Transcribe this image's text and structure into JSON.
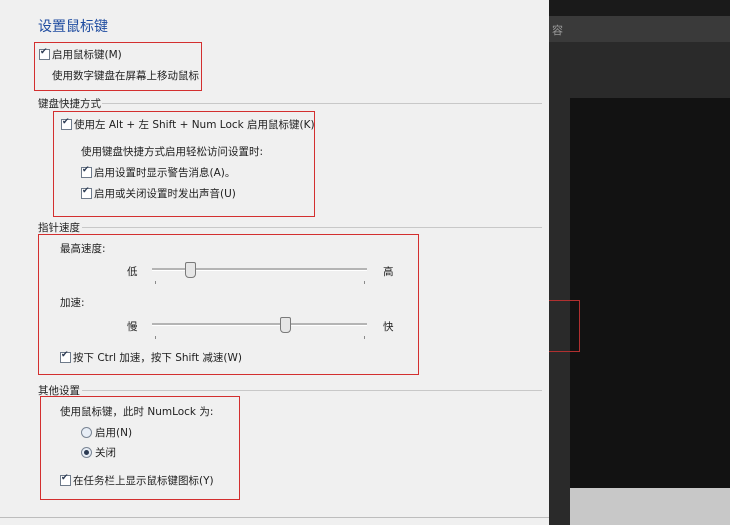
{
  "background": {
    "partial_text": "容"
  },
  "dialog": {
    "title": "设置鼠标键",
    "mouse_keys": {
      "enable_label": "启用鼠标键(M)",
      "enable_checked": true,
      "description": "使用数字键盘在屏幕上移动鼠标"
    },
    "shortcut_group": {
      "title": "键盘快捷方式",
      "shortcut_label": "使用左 Alt + 左 Shift + Num Lock 启用鼠标键(K)",
      "shortcut_checked": true,
      "sub_caption": "使用键盘快捷方式启用轻松访问设置时:",
      "warning_label": "启用设置时显示警告消息(A)。",
      "warning_checked": true,
      "sound_label": "启用或关闭设置时发出声音(U)",
      "sound_checked": true
    },
    "pointer_speed_group": {
      "title": "指针速度",
      "top_speed_label": "最高速度:",
      "top_speed_min": "低",
      "top_speed_max": "高",
      "top_speed_value": 0.18,
      "acceleration_label": "加速:",
      "acceleration_min": "慢",
      "acceleration_max": "快",
      "acceleration_value": 0.62,
      "ctrl_shift_label": "按下 Ctrl 加速，按下 Shift 减速(W)",
      "ctrl_shift_checked": true
    },
    "other_group": {
      "title": "其他设置",
      "numlock_caption": "使用鼠标键，此时 NumLock 为:",
      "numlock_on_label": "启用(N)",
      "numlock_off_label": "关闭",
      "numlock_selected": "off",
      "taskbar_icon_label": "在任务栏上显示鼠标键图标(Y)",
      "taskbar_icon_checked": true
    }
  },
  "colors": {
    "title": "#1f4ca0",
    "highlight_box": "#d32f2f",
    "dialog_bg": "#f0f0f0"
  }
}
